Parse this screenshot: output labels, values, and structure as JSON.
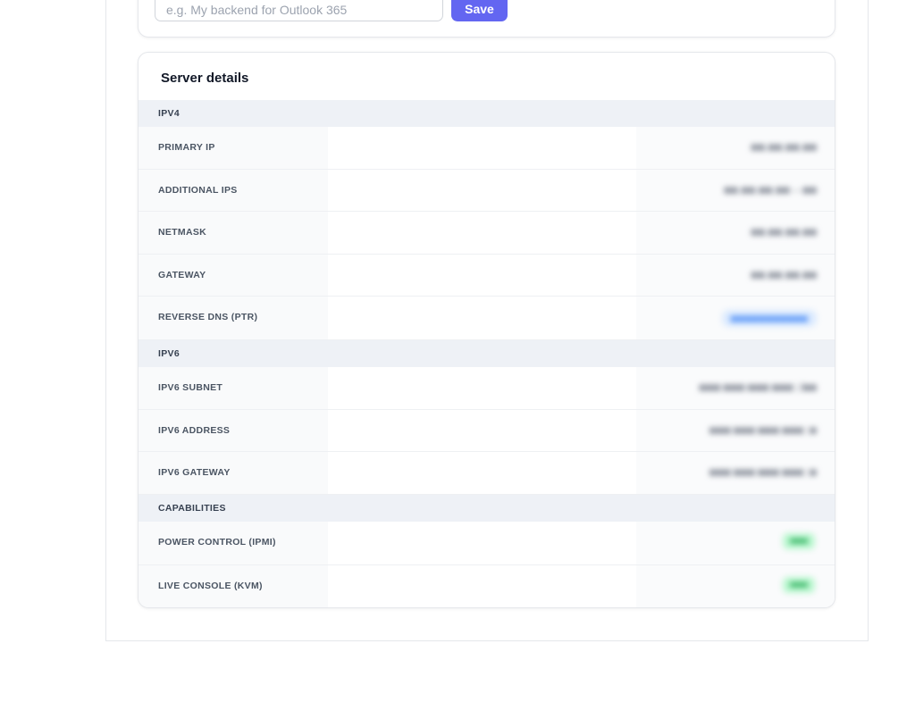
{
  "form": {
    "name_placeholder": "e.g. My backend for Outlook 365",
    "save_label": "Save"
  },
  "details": {
    "title": "Server details",
    "ipv4": {
      "heading": "IPV4",
      "rows": [
        {
          "label": "PRIMARY IP",
          "value": "■■.■■.■■.■■"
        },
        {
          "label": "ADDITIONAL IPS",
          "value": "■■.■■.■■.■■ – ■■"
        },
        {
          "label": "NETMASK",
          "value": "■■.■■.■■.■■"
        },
        {
          "label": "GATEWAY",
          "value": "■■.■■.■■.■■"
        },
        {
          "label": "REVERSE DNS (PTR)",
          "value": "■■■■■■■■■■■"
        }
      ]
    },
    "ipv6": {
      "heading": "IPV6",
      "rows": [
        {
          "label": "IPV6 SUBNET",
          "value": "■■■:■■■:■■■:■■■::/■■"
        },
        {
          "label": "IPV6 ADDRESS",
          "value": "■■■:■■■:■■■:■■■::■"
        },
        {
          "label": "IPV6 GATEWAY",
          "value": "■■■:■■■:■■■:■■■::■"
        }
      ]
    },
    "capabilities": {
      "heading": "CAPABILITIES",
      "rows": [
        {
          "label": "POWER CONTROL (IPMI)",
          "value": "■■■"
        },
        {
          "label": "LIVE CONSOLE (KVM)",
          "value": "■■■"
        }
      ]
    }
  },
  "colors": {
    "accent": "#6366f1",
    "section_bg": "#eef1f6",
    "label_bg": "#f9fafb"
  }
}
